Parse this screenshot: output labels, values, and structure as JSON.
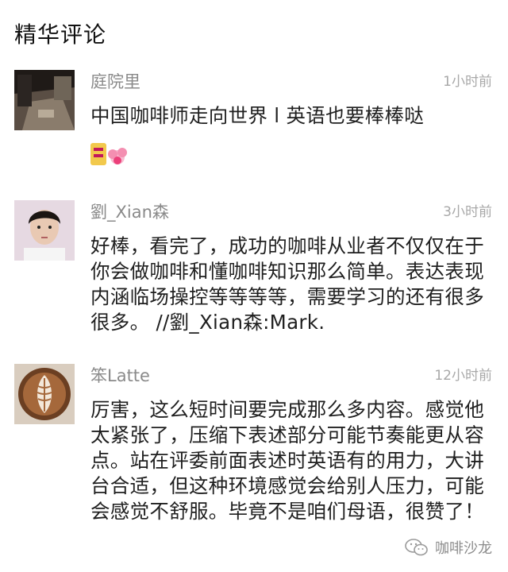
{
  "section": {
    "title": "精华评论"
  },
  "comments": [
    {
      "author": "庭院里",
      "time": "1小时前",
      "text": "中国咖啡师走向世界 l 英语也要棒棒哒",
      "sticker": "flower-sticker-icon"
    },
    {
      "author": "劉_Xian森",
      "time": "3小时前",
      "text": "好棒，看完了，成功的咖啡从业者不仅仅在于你会做咖啡和懂咖啡知识那么简单。表达表现内涵临场操控等等等等，需要学习的还有很多很多。 //劉_Xian森:Mark."
    },
    {
      "author": "笨Latte",
      "time": "12小时前",
      "text": "厉害，这么短时间要完成那么多内容。感觉他太紧张了，压缩下表述部分可能节奏能更从容点。站在评委前面表述时英语有的用力，大讲台合适，但这种环境感觉会给别人压力，可能会感觉不舒服。毕竟不是咱们母语，很赞了！"
    }
  ],
  "watermark": {
    "icon": "wechat-icon",
    "label": "咖啡沙龙"
  },
  "colors": {
    "author": "#8a8a8a",
    "time": "#a8a8a8",
    "text": "#1f1f1f"
  }
}
